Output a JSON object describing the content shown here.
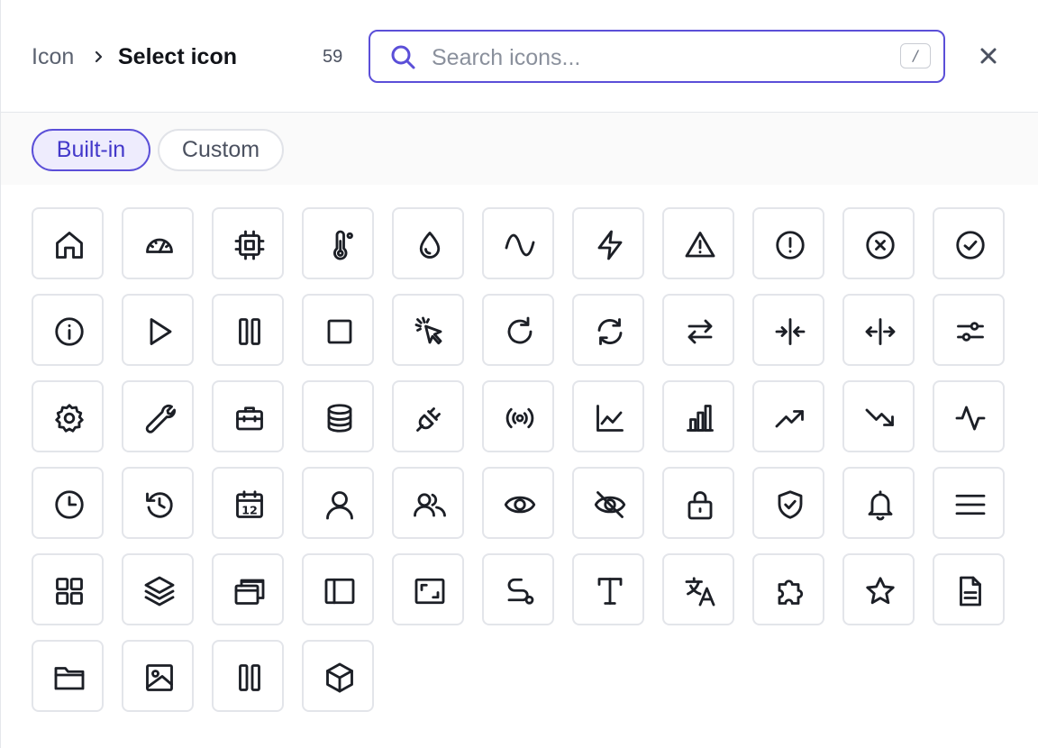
{
  "header": {
    "breadcrumb_root": "Icon",
    "breadcrumb_separator": "›",
    "breadcrumb_current": "Select icon",
    "count": "59",
    "search_placeholder": "Search icons...",
    "search_value": "",
    "shortcut_key": "/",
    "close_label": "×"
  },
  "tabs": [
    {
      "label": "Built-in",
      "selected": true
    },
    {
      "label": "Custom",
      "selected": false
    }
  ],
  "colors": {
    "accent": "#5b4fd8",
    "accent_bg": "#eeecfd",
    "text": "#111318",
    "muted": "#5b6270",
    "tile_border": "#e3e5ea"
  },
  "icons": [
    "home-icon",
    "gauge-icon",
    "cpu-icon",
    "thermometer-icon",
    "droplet-icon",
    "wave-icon",
    "zap-icon",
    "alert-triangle-icon",
    "alert-circle-icon",
    "x-circle-icon",
    "check-circle-icon",
    "info-icon",
    "play-icon",
    "pause-icon",
    "square-icon",
    "cursor-click-icon",
    "rotate-cw-icon",
    "refresh-icon",
    "arrows-left-right-icon",
    "collapse-horizontal-icon",
    "expand-horizontal-icon",
    "sliders-icon",
    "settings-icon",
    "wrench-icon",
    "briefcase-icon",
    "database-icon",
    "plug-icon",
    "broadcast-icon",
    "line-chart-icon",
    "bar-chart-icon",
    "trending-up-icon",
    "trending-down-icon",
    "activity-icon",
    "clock-icon",
    "history-icon",
    "calendar-icon",
    "user-icon",
    "users-icon",
    "eye-icon",
    "eye-off-icon",
    "lock-icon",
    "shield-check-icon",
    "bell-icon",
    "menu-icon",
    "grid-icon",
    "layers-icon",
    "windows-icon",
    "sidebar-icon",
    "maximize-icon",
    "route-icon",
    "type-icon",
    "languages-icon",
    "puzzle-icon",
    "star-icon",
    "file-text-icon",
    "folder-icon",
    "image-icon",
    "columns-icon",
    "box-icon"
  ],
  "calendar_day": "12"
}
